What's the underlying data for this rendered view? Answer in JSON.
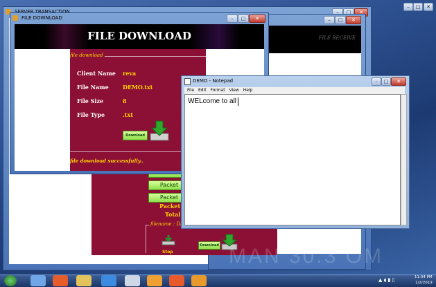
{
  "server_window": {
    "title": "SERVER TRANSACTION",
    "min": "–",
    "max": "□",
    "close": "✕"
  },
  "behind_window": {
    "header_text": "FILE RECEIVE",
    "min": "–",
    "max": "□",
    "close": "✕"
  },
  "download_window": {
    "title": "FILE DOWNLOAD",
    "heading": "FILE DOWNLOAD",
    "group_label": "file download",
    "fields": [
      {
        "label": "Client Name",
        "value": "reva"
      },
      {
        "label": "File Name",
        "value": "DEMO.txt"
      },
      {
        "label": "File Size",
        "value": "8"
      },
      {
        "label": "File Type",
        "value": ".txt"
      }
    ],
    "download_button": "Download",
    "status": "file download successfully..",
    "min": "–",
    "max": "□",
    "close": "✕"
  },
  "server_panel": {
    "packet_buttons": [
      "Packet",
      "Packet",
      "Packet"
    ],
    "packet_size_label": "Packet S",
    "total_size_label": "Total S",
    "filename_label": "filename : DEMO.txt",
    "download_button": "Download",
    "stop_label": "Stop"
  },
  "notepad": {
    "title": "DEMO - Notepad",
    "menu": [
      "File",
      "Edit",
      "Format",
      "View",
      "Help"
    ],
    "content": "WELcome to all",
    "min": "–",
    "max": "□",
    "close": "✕"
  },
  "outer_controls": {
    "min": "–",
    "max": "□",
    "close": "✕"
  },
  "watermark": "MAN 30.3 OM",
  "taskbar": {
    "time": "11:04 PM",
    "date": "1/2/2019"
  },
  "colors": {
    "maroon": "#8c1035",
    "heading_bg": "#000000",
    "field_text": "#ffd200",
    "button_green": "#8ee04a"
  }
}
